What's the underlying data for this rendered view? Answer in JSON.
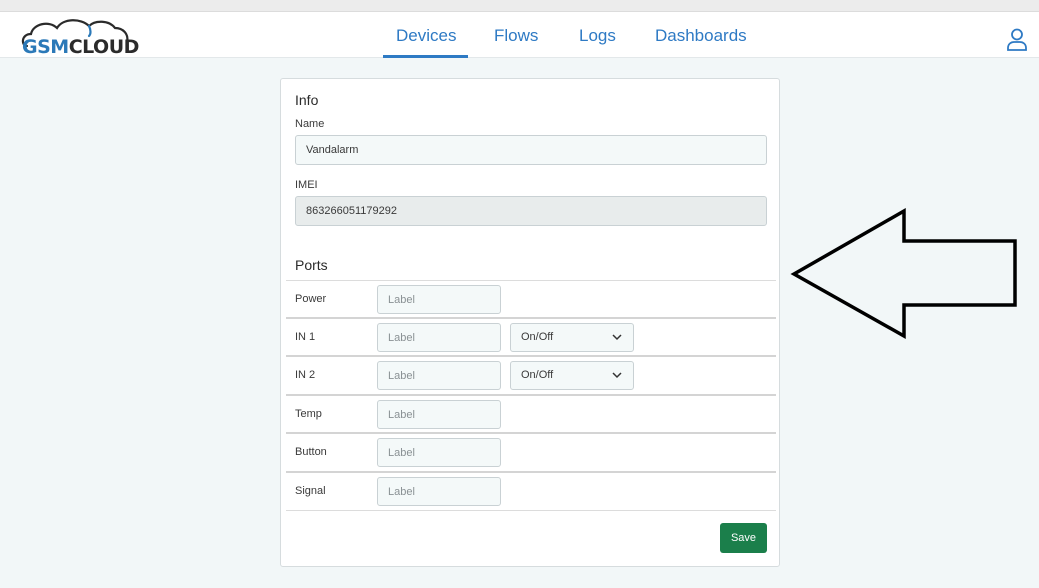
{
  "brand": {
    "logo_gsm": "GSM",
    "logo_cloud": "CLOUD"
  },
  "nav": {
    "items": [
      {
        "label": "Devices",
        "active": true
      },
      {
        "label": "Flows",
        "active": false
      },
      {
        "label": "Logs",
        "active": false
      },
      {
        "label": "Dashboards",
        "active": false
      }
    ],
    "user_icon": "user-icon"
  },
  "info": {
    "title": "Info",
    "name_label": "Name",
    "name_value": "Vandalarm",
    "imei_label": "IMEI",
    "imei_value": "863266051179292"
  },
  "ports": {
    "title": "Ports",
    "label_placeholder": "Label",
    "rows": [
      {
        "name": "Power",
        "mode": null
      },
      {
        "name": "IN 1",
        "mode": "On/Off"
      },
      {
        "name": "IN 2",
        "mode": "On/Off"
      },
      {
        "name": "Temp",
        "mode": null
      },
      {
        "name": "Button",
        "mode": null
      },
      {
        "name": "Signal",
        "mode": null
      }
    ]
  },
  "actions": {
    "save_label": "Save"
  },
  "colors": {
    "accent": "#2e7ac4",
    "save": "#1b7f4b",
    "background": "#f2f7f8"
  },
  "annotation": "arrow-pointing-left"
}
